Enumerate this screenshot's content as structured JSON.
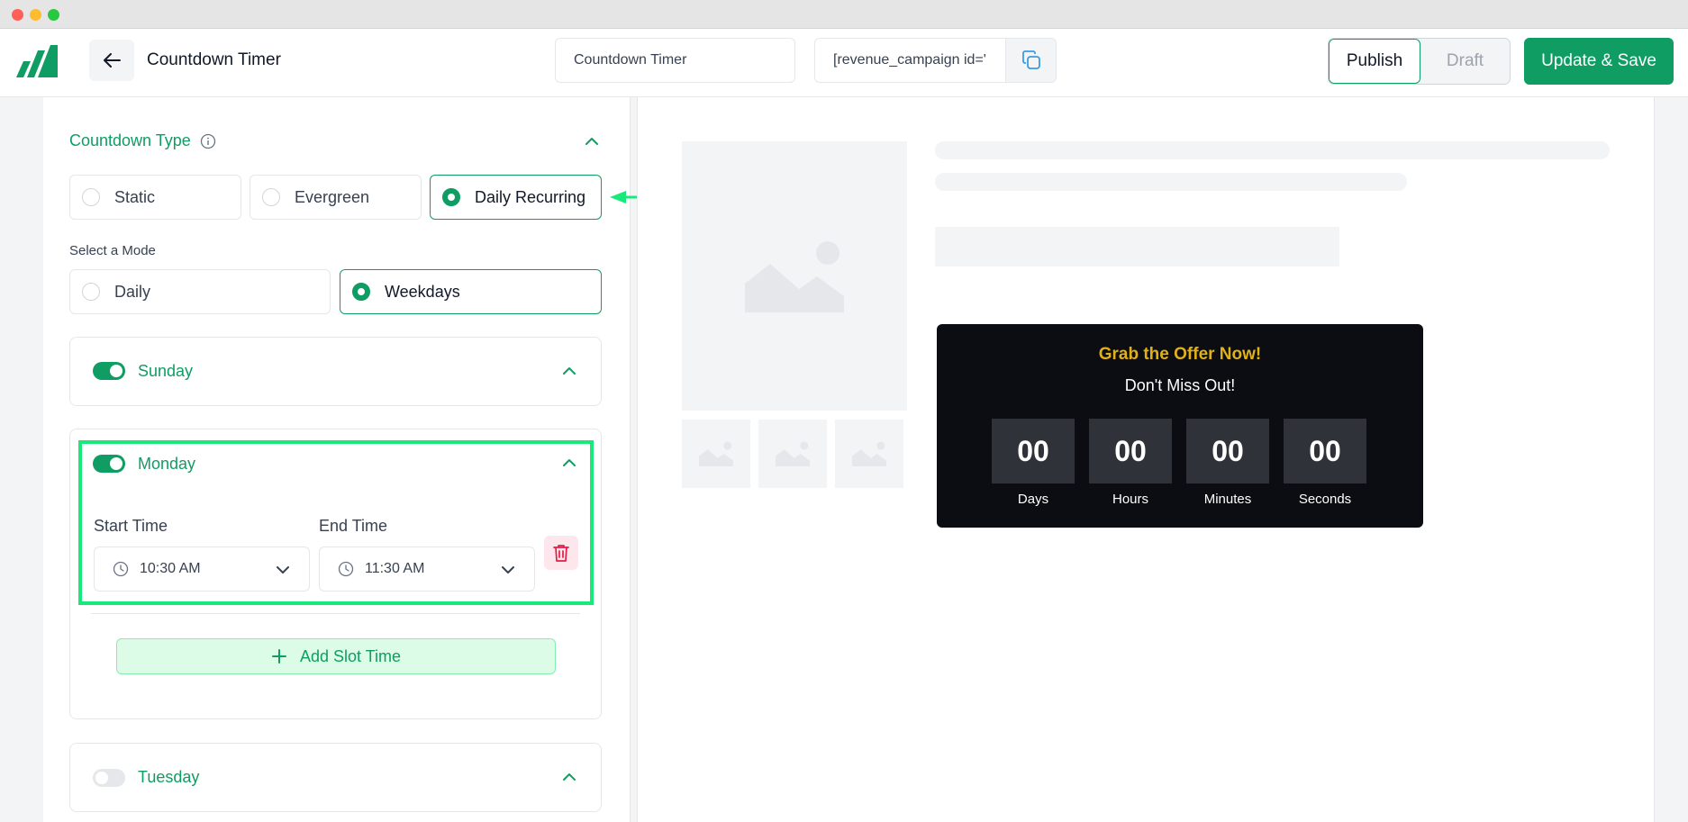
{
  "header": {
    "page_title": "Countdown Timer",
    "campaign_name_value": "Countdown Timer",
    "shortcode_value": "[revenue_campaign id='",
    "publish_label": "Publish",
    "draft_label": "Draft",
    "save_label": "Update & Save",
    "accent_color": "#0f9d63"
  },
  "settings": {
    "countdown_type_title": "Countdown Type",
    "countdown_types": [
      {
        "label": "Static",
        "selected": false
      },
      {
        "label": "Evergreen",
        "selected": false
      },
      {
        "label": "Daily Recurring",
        "selected": true
      }
    ],
    "mode_label": "Select a Mode",
    "modes": [
      {
        "label": "Daily",
        "selected": false
      },
      {
        "label": "Weekdays",
        "selected": true
      }
    ],
    "days": [
      {
        "label": "Sunday",
        "enabled": true
      },
      {
        "label": "Monday",
        "enabled": true
      },
      {
        "label": "Tuesday",
        "enabled": false
      }
    ],
    "start_time_label": "Start Time",
    "end_time_label": "End Time",
    "start_time_value": "10:30 AM",
    "end_time_value": "11:30 AM",
    "add_slot_label": "Add Slot Time"
  },
  "preview": {
    "headline": "Grab the Offer Now!",
    "subheadline": "Don't Miss Out!",
    "units": [
      {
        "value": "00",
        "label": "Days"
      },
      {
        "value": "00",
        "label": "Hours"
      },
      {
        "value": "00",
        "label": "Minutes"
      },
      {
        "value": "00",
        "label": "Seconds"
      }
    ],
    "headline_color": "#e0b019",
    "timer_bg": "#0b0d12"
  }
}
